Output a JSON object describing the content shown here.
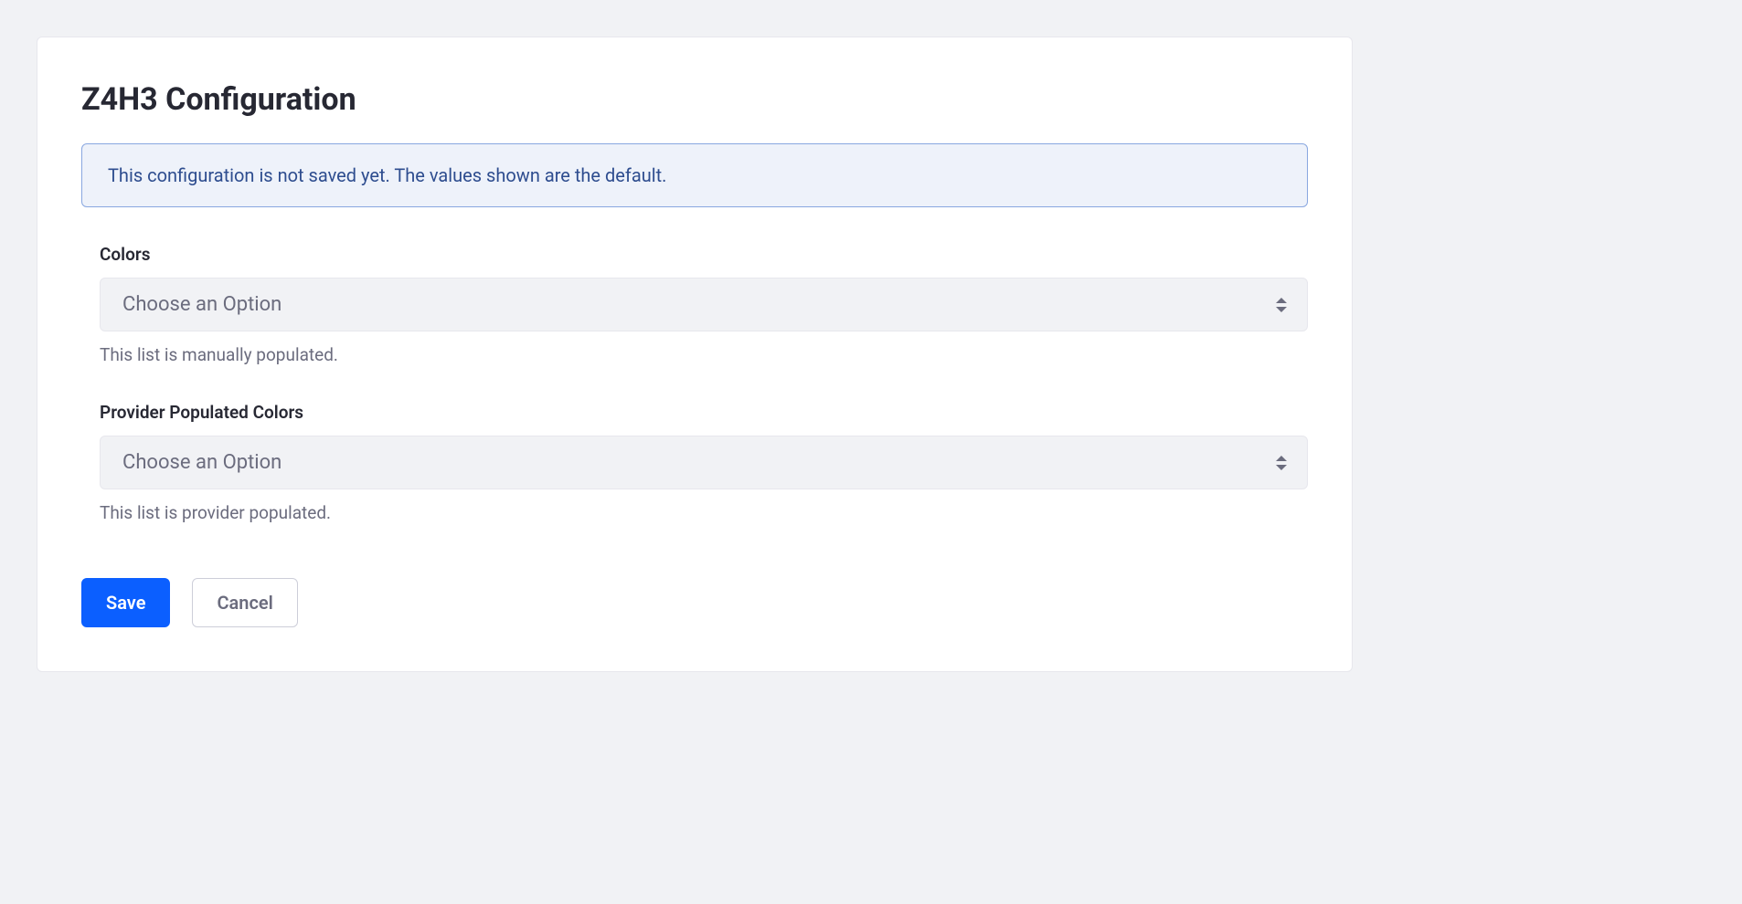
{
  "page": {
    "title": "Z4H3 Configuration"
  },
  "alert": {
    "message": "This configuration is not saved yet. The values shown are the default."
  },
  "form": {
    "colors": {
      "label": "Colors",
      "placeholder": "Choose an Option",
      "help": "This list is manually populated."
    },
    "providerColors": {
      "label": "Provider Populated Colors",
      "placeholder": "Choose an Option",
      "help": "This list is provider populated."
    }
  },
  "buttons": {
    "save": "Save",
    "cancel": "Cancel"
  }
}
